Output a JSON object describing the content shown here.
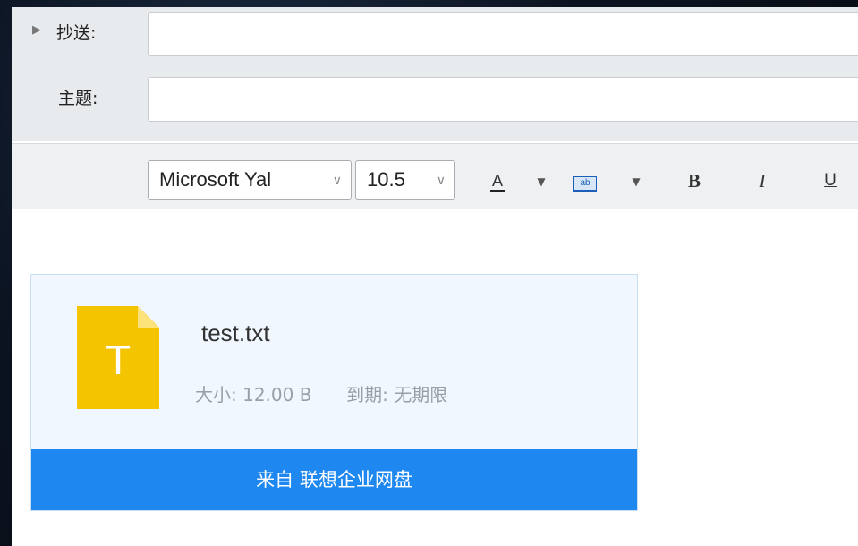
{
  "fields": {
    "cc_label": "抄送:",
    "cc_value": "",
    "subject_label": "主题:",
    "subject_value": ""
  },
  "toolbar": {
    "font_family": "Microsoft Yal",
    "font_size": "10.5",
    "font_color_glyph": "A",
    "highlight_glyph": "ab",
    "bold_glyph": "B",
    "italic_glyph": "I",
    "underline_glyph": "U"
  },
  "attachment": {
    "icon_letter": "T",
    "icon_color": "#f5c400",
    "file_name": "test.txt",
    "size_label": "大小:",
    "size_value": "12.00 B",
    "expiry_label": "到期:",
    "expiry_value": "无期限",
    "footer_text": "来自 联想企业网盘",
    "footer_color": "#1e87f0"
  }
}
